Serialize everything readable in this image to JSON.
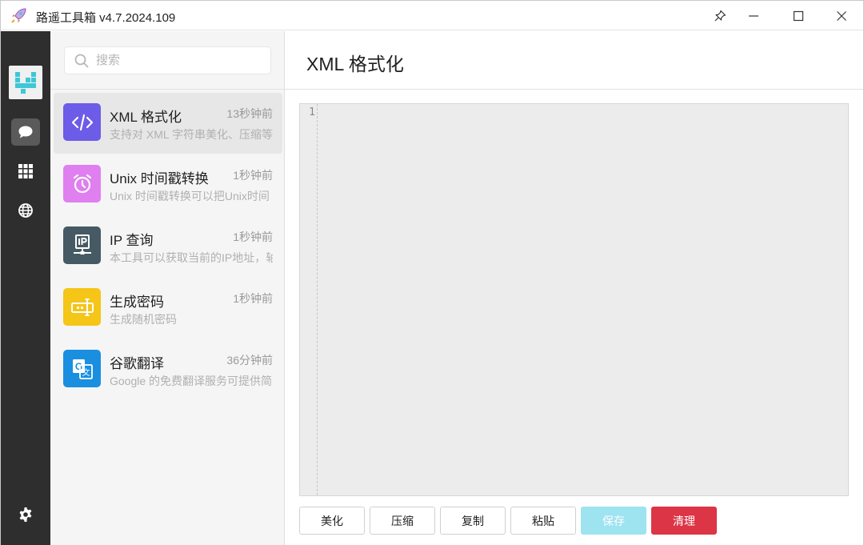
{
  "window": {
    "title": "路遥工具箱 v4.7.2024.109"
  },
  "rail": {
    "items": [
      {
        "icon": "chat-icon",
        "active": true
      },
      {
        "icon": "apps-grid-icon",
        "active": false
      },
      {
        "icon": "globe-icon",
        "active": false
      },
      {
        "icon": "gear-icon",
        "active": false
      }
    ]
  },
  "search": {
    "placeholder": "搜索",
    "value": ""
  },
  "tools": [
    {
      "name": "XML 格式化",
      "time": "13秒钟前",
      "desc": "支持对 XML 字符串美化、压缩等",
      "icon": "code-icon",
      "color": "#6c5ce7"
    },
    {
      "name": "Unix 时间戳转换",
      "time": "1秒钟前",
      "desc": "Unix 时间戳转换可以把Unix时间",
      "icon": "alarm-clock-icon",
      "color": "#df7ff0"
    },
    {
      "name": "IP 查询",
      "time": "1秒钟前",
      "desc": "本工具可以获取当前的IP地址，轴",
      "icon": "ip-network-icon",
      "color": "#455a64"
    },
    {
      "name": "生成密码",
      "time": "1秒钟前",
      "desc": "生成随机密码",
      "icon": "password-icon",
      "color": "#f5c518"
    },
    {
      "name": "谷歌翻译",
      "time": "36分钟前",
      "desc": "Google 的免费翻译服务可提供简",
      "icon": "translate-icon",
      "color": "#1a8fe0"
    }
  ],
  "main": {
    "title": "XML 格式化",
    "editor": {
      "line_number": "1",
      "content": ""
    },
    "buttons": {
      "beautify": "美化",
      "compress": "压缩",
      "copy": "复制",
      "paste": "粘贴",
      "save": "保存",
      "clear": "清理"
    }
  },
  "colors": {
    "rail_bg": "#2e2e2e",
    "save_disabled": "#9ee3f0",
    "clear_danger": "#dc3545"
  }
}
